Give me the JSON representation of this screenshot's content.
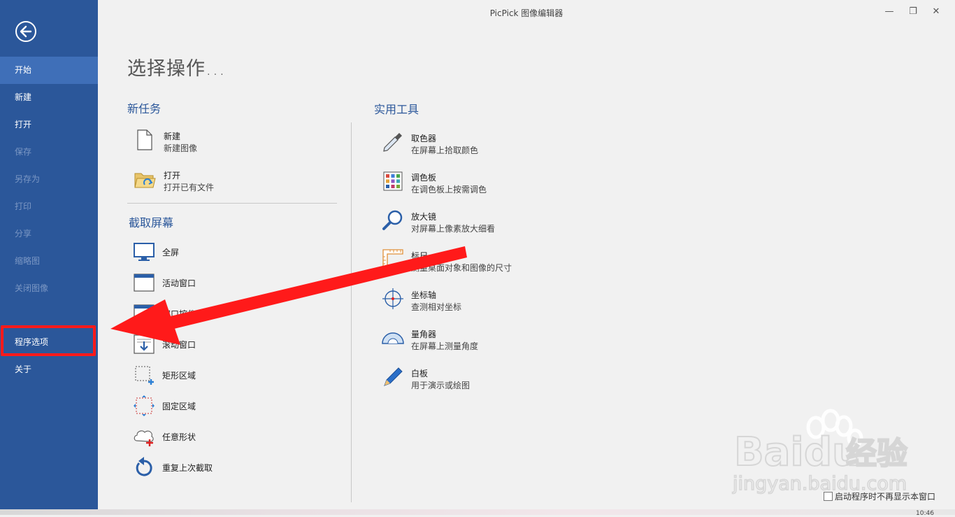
{
  "window": {
    "title": "PicPick 图像编辑器",
    "min_glyph": "—",
    "max_glyph": "❐",
    "close_glyph": "✕"
  },
  "sidebar": {
    "items": [
      {
        "label": "开始",
        "state": "active"
      },
      {
        "label": "新建",
        "state": "normal"
      },
      {
        "label": "打开",
        "state": "normal"
      },
      {
        "label": "保存",
        "state": "disabled"
      },
      {
        "label": "另存为",
        "state": "disabled"
      },
      {
        "label": "打印",
        "state": "disabled"
      },
      {
        "label": "分享",
        "state": "disabled"
      },
      {
        "label": "缩略图",
        "state": "disabled"
      },
      {
        "label": "关闭图像",
        "state": "disabled"
      },
      {
        "label": "程序选项",
        "state": "highlighted"
      },
      {
        "label": "关于",
        "state": "normal"
      }
    ]
  },
  "main": {
    "page_title": "选择操作...",
    "new_task": {
      "title": "新任务",
      "items": [
        {
          "title": "新建",
          "subtitle": "新建图像",
          "icon": "new-file-icon"
        },
        {
          "title": "打开",
          "subtitle": "打开已有文件",
          "icon": "open-folder-icon"
        }
      ]
    },
    "capture": {
      "title": "截取屏幕",
      "items": [
        {
          "title": "全屏",
          "icon": "monitor-icon"
        },
        {
          "title": "活动窗口",
          "icon": "window-icon"
        },
        {
          "title": "窗口控件",
          "icon": "window-control-icon"
        },
        {
          "title": "滚动窗口",
          "icon": "scroll-window-icon"
        },
        {
          "title": "矩形区域",
          "icon": "rectangle-select-icon"
        },
        {
          "title": "固定区域",
          "icon": "fixed-region-icon"
        },
        {
          "title": "任意形状",
          "icon": "freehand-icon"
        },
        {
          "title": "重复上次截取",
          "icon": "repeat-icon"
        }
      ]
    },
    "tools": {
      "title": "实用工具",
      "items": [
        {
          "title": "取色器",
          "subtitle": "在屏幕上拾取颜色",
          "icon": "eyedropper-icon"
        },
        {
          "title": "调色板",
          "subtitle": "在调色板上按需调色",
          "icon": "palette-icon"
        },
        {
          "title": "放大镜",
          "subtitle": "对屏幕上像素放大细看",
          "icon": "magnifier-icon"
        },
        {
          "title": "标尺",
          "subtitle": "测量桌面对象和图像的尺寸",
          "icon": "ruler-icon"
        },
        {
          "title": "坐标轴",
          "subtitle": "查测相对坐标",
          "icon": "crosshair-icon"
        },
        {
          "title": "量角器",
          "subtitle": "在屏幕上测量角度",
          "icon": "protractor-icon"
        },
        {
          "title": "白板",
          "subtitle": "用于演示或绘图",
          "icon": "pen-icon"
        }
      ]
    },
    "startup_checkbox": {
      "label": "启动程序时不再显示本窗口",
      "checked": false
    }
  },
  "watermark": {
    "brand_1": "Bai",
    "brand_2": "du",
    "brand_cn": "经验",
    "url": "jingyan.baidu.com"
  },
  "taskbar": {
    "clock": "10:46"
  },
  "colors": {
    "sidebar": "#2b579a",
    "accent": "#2b579a",
    "annotation": "#ff1a1a"
  }
}
